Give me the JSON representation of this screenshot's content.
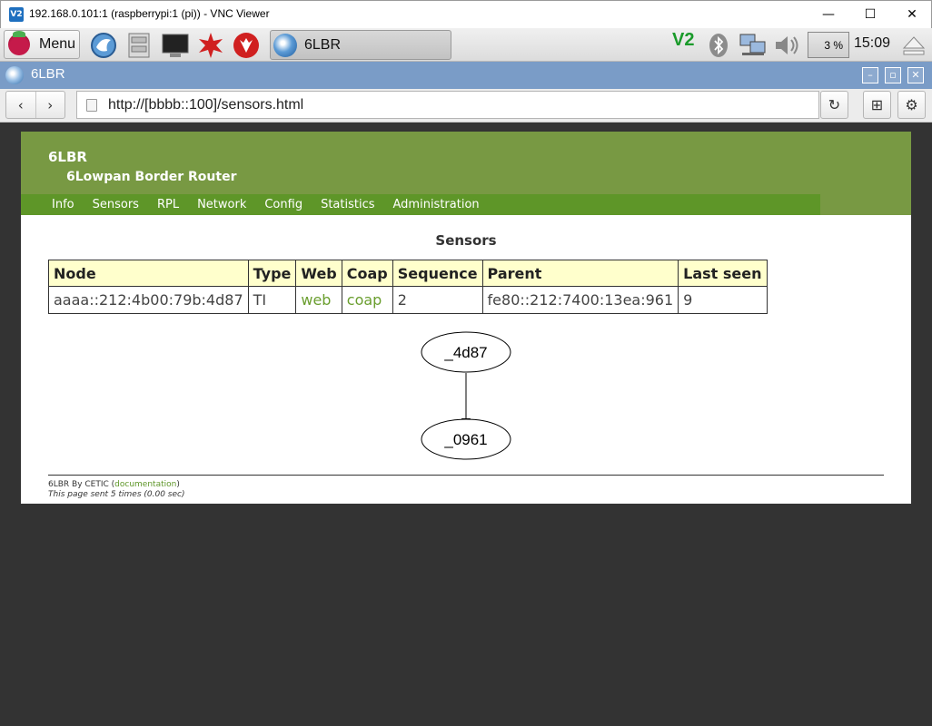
{
  "vnc_window": {
    "title": "192.168.0.101:1 (raspberrypi:1 (pi)) - VNC Viewer",
    "logo": "V2",
    "controls": {
      "minimize": "—",
      "maximize": "☐",
      "close": "✕"
    }
  },
  "pi_panel": {
    "menu_label": "Menu",
    "launchers": [
      "web-browser",
      "file-manager",
      "terminal",
      "mathematica",
      "wolfram"
    ],
    "task_label": "6LBR",
    "tray": {
      "vnc_logo": "V2",
      "cpu_usage": "3 %",
      "clock": "15:09"
    }
  },
  "browser": {
    "title": "6LBR",
    "controls": {
      "minimize": "–",
      "restore": "▫",
      "close": "✕"
    },
    "back": "‹",
    "forward": "›",
    "url": "http://[bbbb::100]/sensors.html",
    "reload": "↻",
    "bookmark": "⊞",
    "settings": "⚙"
  },
  "site": {
    "name": "6LBR",
    "subtitle": "6Lowpan Border Router",
    "nav": [
      "Info",
      "Sensors",
      "RPL",
      "Network",
      "Config",
      "Statistics",
      "Administration"
    ],
    "section_title": "Sensors",
    "table": {
      "headers": [
        "Node",
        "Type",
        "Web",
        "Coap",
        "Sequence",
        "Parent",
        "Last seen"
      ],
      "rows": [
        {
          "node": "aaaa::212:4b00:79b:4d87",
          "type": "TI",
          "web": "web",
          "coap": "coap",
          "sequence": "2",
          "parent": "fe80::212:7400:13ea:961",
          "last_seen": "9"
        }
      ]
    },
    "graph": {
      "nodes": [
        "_4d87",
        "_0961"
      ]
    },
    "footer": {
      "by_prefix": "6LBR By CETIC (",
      "doc_link": "documentation",
      "by_suffix": ")",
      "sent": "This page sent 5 times (0.00 sec)"
    }
  },
  "colors": {
    "header_green": "#789943",
    "nav_green": "#5e9628",
    "table_header": "#ffffcc",
    "link_green": "#6a9e2e",
    "viewport_bg": "#333333",
    "browser_title_blue": "#7a9cc7"
  }
}
